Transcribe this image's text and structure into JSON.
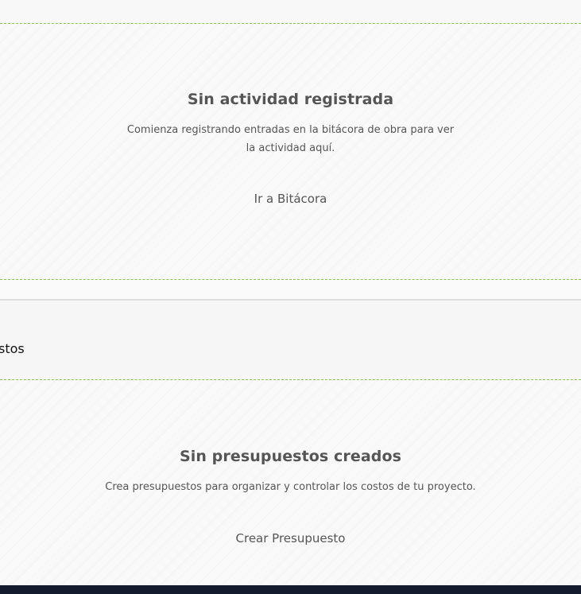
{
  "activity_empty": {
    "title": "Sin actividad registrada",
    "description": "Comienza registrando entradas en la bitácora de obra para ver la actividad aquí.",
    "action_label": "Ir a Bitácora"
  },
  "budgets_section": {
    "title": "uestos"
  },
  "budgets_empty": {
    "title": "Sin presupuestos creados",
    "description": "Crea presupuestos para organizar y controlar los costos de tu proyecto.",
    "action_label": "Crear Presupuesto"
  },
  "colors": {
    "dashed_border": "#8bc34a",
    "text": "#555555",
    "footer_bar": "#151b2e"
  }
}
